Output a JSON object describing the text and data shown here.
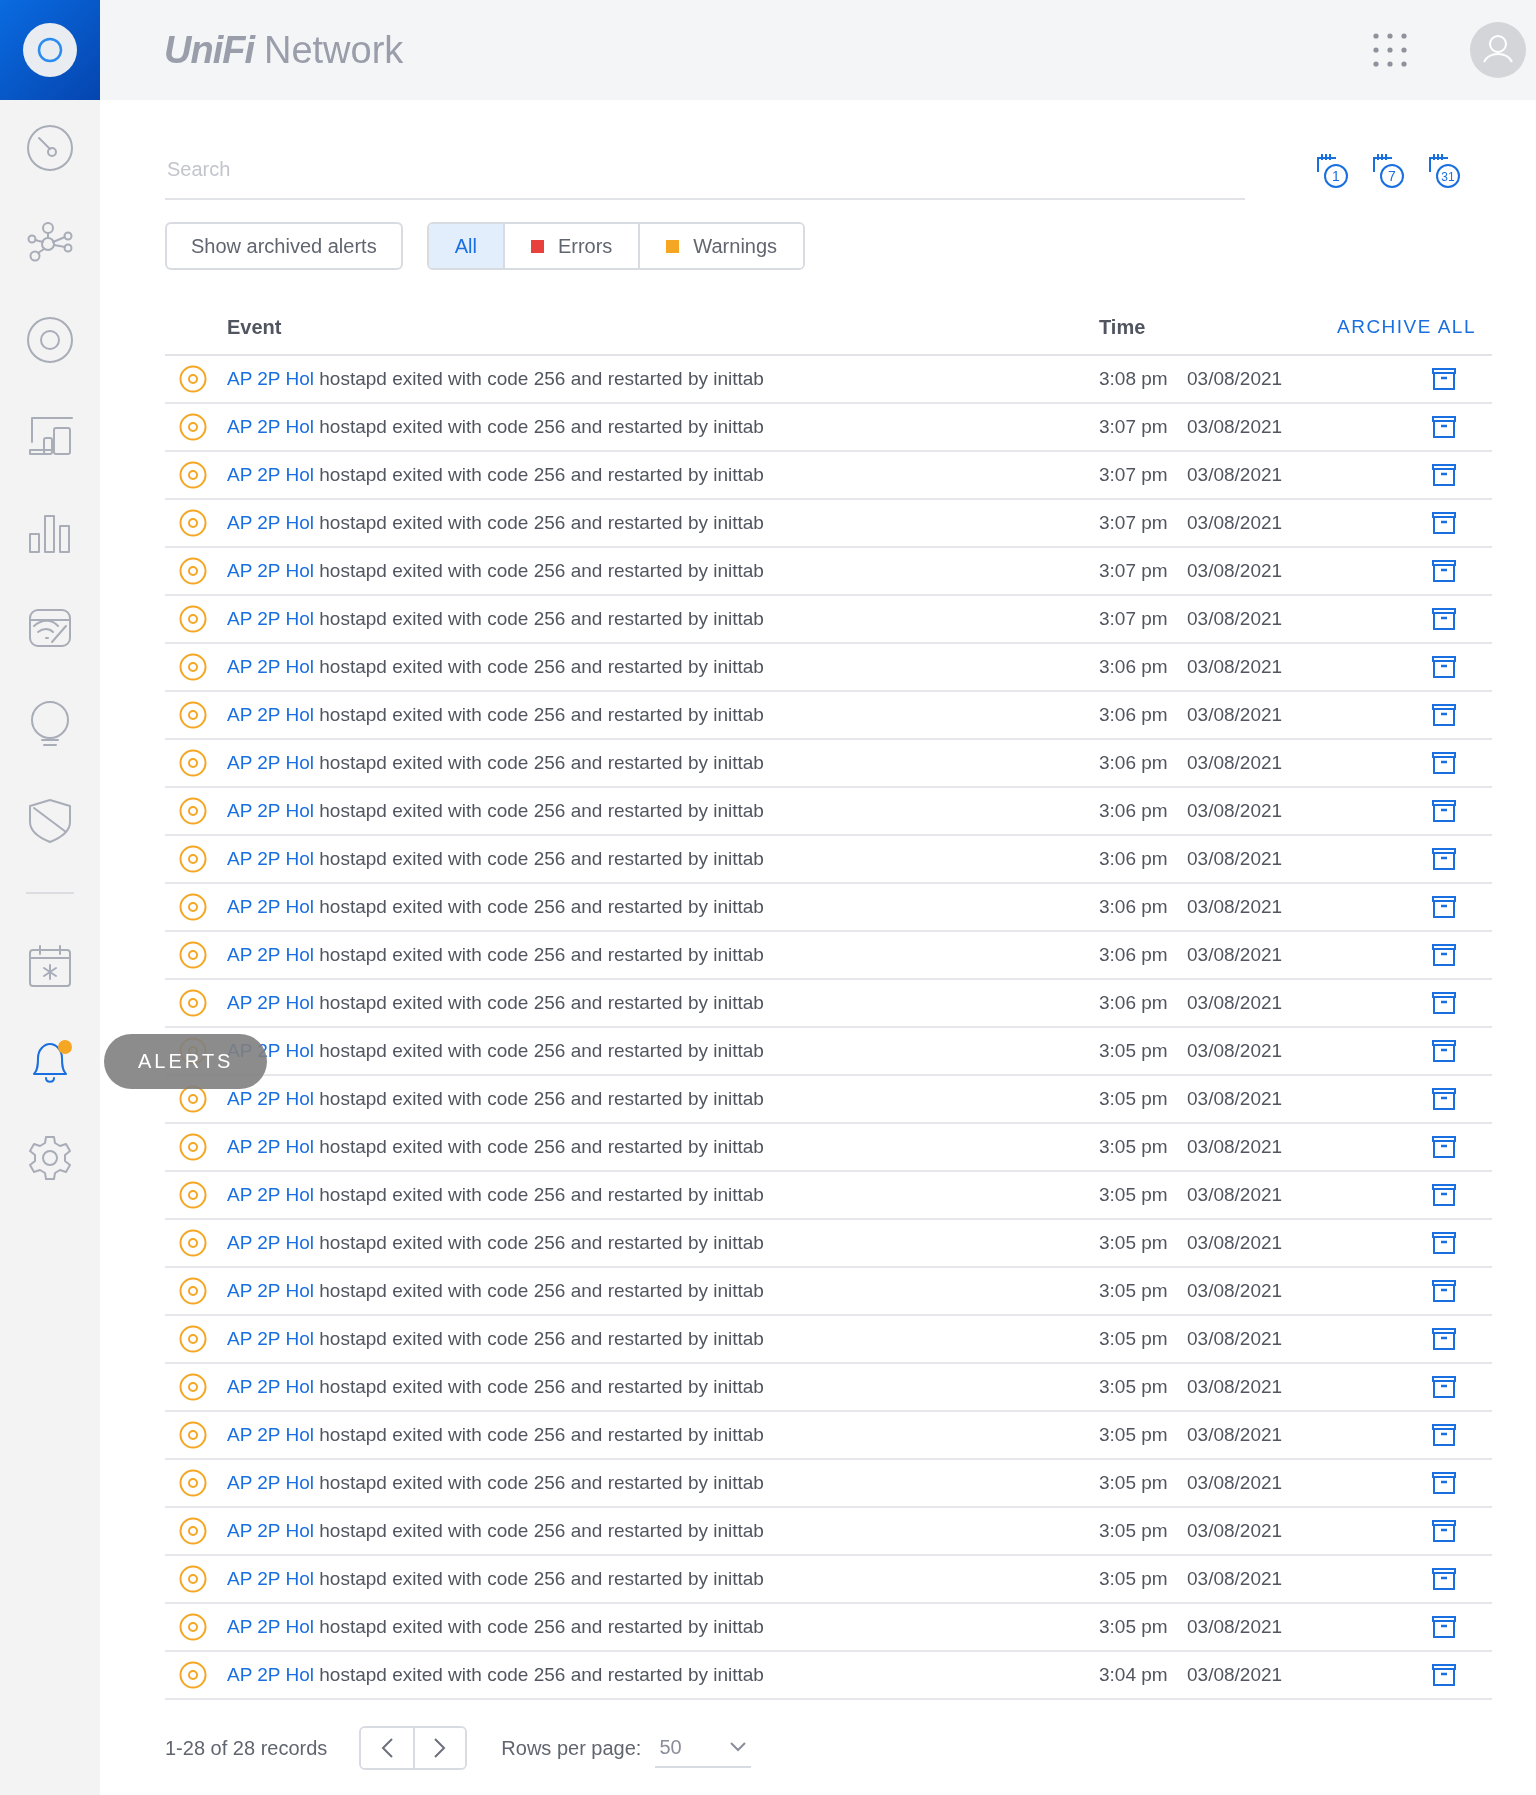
{
  "header": {
    "logo_brand": "UniFi",
    "logo_product": "Network"
  },
  "sidebar": {
    "items": [
      {
        "kind": "dashboard",
        "selected": false,
        "badge": false
      },
      {
        "kind": "topology",
        "selected": false,
        "badge": false
      },
      {
        "kind": "devices",
        "selected": false,
        "badge": false
      },
      {
        "kind": "clients",
        "selected": false,
        "badge": false
      },
      {
        "kind": "statistics",
        "selected": false,
        "badge": false
      },
      {
        "kind": "insights",
        "selected": false,
        "badge": false
      },
      {
        "kind": "bulb",
        "selected": false,
        "badge": false
      },
      {
        "kind": "shield",
        "selected": false,
        "badge": false
      },
      {
        "kind": "divider"
      },
      {
        "kind": "events",
        "selected": false,
        "badge": false
      },
      {
        "kind": "alerts",
        "selected": true,
        "badge": true,
        "tooltip": "ALERTS"
      },
      {
        "kind": "settings",
        "selected": false,
        "badge": false
      }
    ]
  },
  "search": {
    "placeholder": "Search"
  },
  "ranges": [
    {
      "label": "1"
    },
    {
      "label": "7"
    },
    {
      "label": "31"
    }
  ],
  "archived_button": "Show archived alerts",
  "filters": [
    {
      "label": "All",
      "selected": true
    },
    {
      "label": "Errors",
      "selected": false,
      "color": "#e8403d"
    },
    {
      "label": "Warnings",
      "selected": false,
      "color": "#f5a623"
    }
  ],
  "table": {
    "columns": [
      "Event",
      "Time"
    ],
    "archive_all": "ARCHIVE ALL",
    "rows": [
      {
        "device": "AP 2P Hol",
        "message": "hostapd exited with code 256 and restarted by inittab",
        "time": "3:08 pm",
        "date": "03/08/2021"
      },
      {
        "device": "AP 2P Hol",
        "message": "hostapd exited with code 256 and restarted by inittab",
        "time": "3:07 pm",
        "date": "03/08/2021"
      },
      {
        "device": "AP 2P Hol",
        "message": "hostapd exited with code 256 and restarted by inittab",
        "time": "3:07 pm",
        "date": "03/08/2021"
      },
      {
        "device": "AP 2P Hol",
        "message": "hostapd exited with code 256 and restarted by inittab",
        "time": "3:07 pm",
        "date": "03/08/2021"
      },
      {
        "device": "AP 2P Hol",
        "message": "hostapd exited with code 256 and restarted by inittab",
        "time": "3:07 pm",
        "date": "03/08/2021"
      },
      {
        "device": "AP 2P Hol",
        "message": "hostapd exited with code 256 and restarted by inittab",
        "time": "3:07 pm",
        "date": "03/08/2021"
      },
      {
        "device": "AP 2P Hol",
        "message": "hostapd exited with code 256 and restarted by inittab",
        "time": "3:06 pm",
        "date": "03/08/2021"
      },
      {
        "device": "AP 2P Hol",
        "message": "hostapd exited with code 256 and restarted by inittab",
        "time": "3:06 pm",
        "date": "03/08/2021"
      },
      {
        "device": "AP 2P Hol",
        "message": "hostapd exited with code 256 and restarted by inittab",
        "time": "3:06 pm",
        "date": "03/08/2021"
      },
      {
        "device": "AP 2P Hol",
        "message": "hostapd exited with code 256 and restarted by inittab",
        "time": "3:06 pm",
        "date": "03/08/2021"
      },
      {
        "device": "AP 2P Hol",
        "message": "hostapd exited with code 256 and restarted by inittab",
        "time": "3:06 pm",
        "date": "03/08/2021"
      },
      {
        "device": "AP 2P Hol",
        "message": "hostapd exited with code 256 and restarted by inittab",
        "time": "3:06 pm",
        "date": "03/08/2021"
      },
      {
        "device": "AP 2P Hol",
        "message": "hostapd exited with code 256 and restarted by inittab",
        "time": "3:06 pm",
        "date": "03/08/2021"
      },
      {
        "device": "AP 2P Hol",
        "message": "hostapd exited with code 256 and restarted by inittab",
        "time": "3:06 pm",
        "date": "03/08/2021"
      },
      {
        "device": "AP 2P Hol",
        "message": "hostapd exited with code 256 and restarted by inittab",
        "time": "3:05 pm",
        "date": "03/08/2021"
      },
      {
        "device": "AP 2P Hol",
        "message": "hostapd exited with code 256 and restarted by inittab",
        "time": "3:05 pm",
        "date": "03/08/2021"
      },
      {
        "device": "AP 2P Hol",
        "message": "hostapd exited with code 256 and restarted by inittab",
        "time": "3:05 pm",
        "date": "03/08/2021"
      },
      {
        "device": "AP 2P Hol",
        "message": "hostapd exited with code 256 and restarted by inittab",
        "time": "3:05 pm",
        "date": "03/08/2021"
      },
      {
        "device": "AP 2P Hol",
        "message": "hostapd exited with code 256 and restarted by inittab",
        "time": "3:05 pm",
        "date": "03/08/2021"
      },
      {
        "device": "AP 2P Hol",
        "message": "hostapd exited with code 256 and restarted by inittab",
        "time": "3:05 pm",
        "date": "03/08/2021"
      },
      {
        "device": "AP 2P Hol",
        "message": "hostapd exited with code 256 and restarted by inittab",
        "time": "3:05 pm",
        "date": "03/08/2021"
      },
      {
        "device": "AP 2P Hol",
        "message": "hostapd exited with code 256 and restarted by inittab",
        "time": "3:05 pm",
        "date": "03/08/2021"
      },
      {
        "device": "AP 2P Hol",
        "message": "hostapd exited with code 256 and restarted by inittab",
        "time": "3:05 pm",
        "date": "03/08/2021"
      },
      {
        "device": "AP 2P Hol",
        "message": "hostapd exited with code 256 and restarted by inittab",
        "time": "3:05 pm",
        "date": "03/08/2021"
      },
      {
        "device": "AP 2P Hol",
        "message": "hostapd exited with code 256 and restarted by inittab",
        "time": "3:05 pm",
        "date": "03/08/2021"
      },
      {
        "device": "AP 2P Hol",
        "message": "hostapd exited with code 256 and restarted by inittab",
        "time": "3:05 pm",
        "date": "03/08/2021"
      },
      {
        "device": "AP 2P Hol",
        "message": "hostapd exited with code 256 and restarted by inittab",
        "time": "3:05 pm",
        "date": "03/08/2021"
      },
      {
        "device": "AP 2P Hol",
        "message": "hostapd exited with code 256 and restarted by inittab",
        "time": "3:04 pm",
        "date": "03/08/2021"
      }
    ]
  },
  "footer": {
    "records": "1-28 of 28 records",
    "rows_label": "Rows per page:",
    "rows_value": "50"
  }
}
